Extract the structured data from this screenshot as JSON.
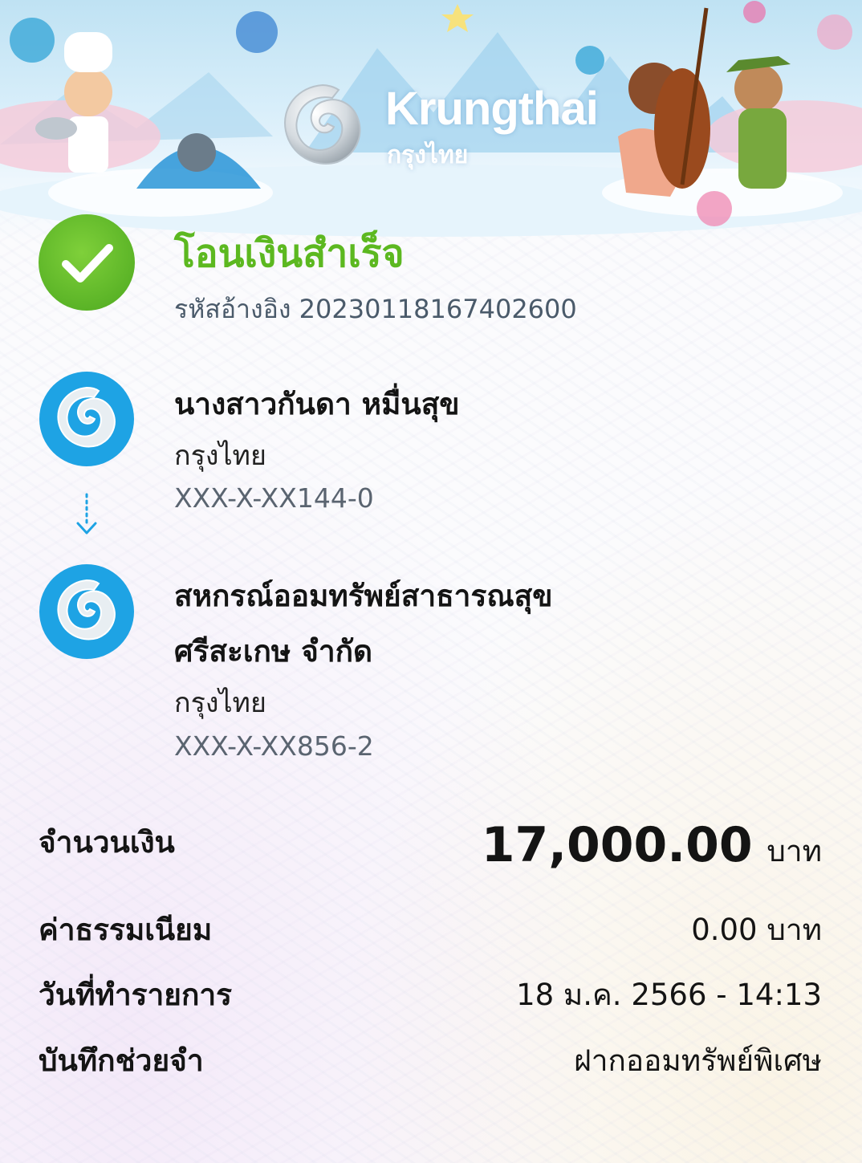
{
  "header": {
    "brand_name": "Krungthai",
    "brand_name_thai": "กรุงไทย"
  },
  "status": {
    "title": "โอนเงินสำเร็จ",
    "reference": "รหัสอ้างอิง 2023011816740260​0"
  },
  "sender": {
    "name": "นางสาวกันดา หมื่นสุข",
    "bank": "กรุงไทย",
    "account": "XXX-X-XX144-0"
  },
  "receiver": {
    "name_line1": "สหกรณ์ออมทรัพย์สาธารณสุข",
    "name_line2": "ศรีสะเกษ จำกัด",
    "bank": "กรุงไทย",
    "account": "XXX-X-XX856-2"
  },
  "details": {
    "amount_label": "จำนวนเงิน",
    "amount_value": "17,000.00",
    "amount_unit": "บาท",
    "fee_label": "ค่าธรรมเนียม",
    "fee_value": "0.00 บาท",
    "date_label": "วันที่ทำรายการ",
    "date_value": "18 ม.ค. 2566 - 14:13",
    "memo_label": "บันทึกช่วยจำ",
    "memo_value": "ฝากออมทรัพย์พิเศษ"
  },
  "colors": {
    "success_green": "#5cb820",
    "krungthai_blue": "#1ea3e4"
  }
}
